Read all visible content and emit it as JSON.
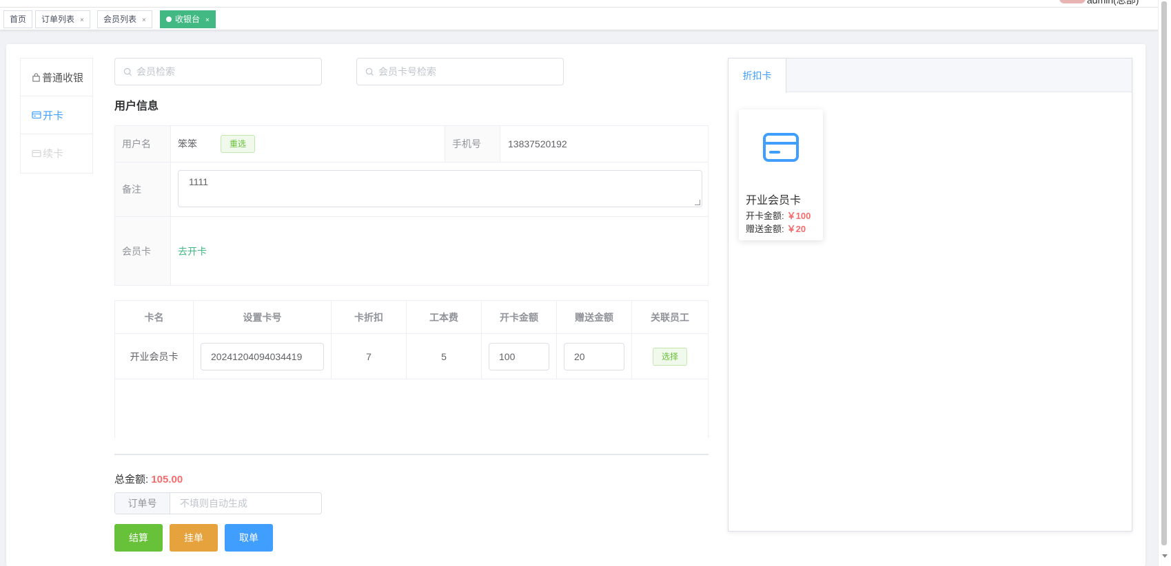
{
  "header": {
    "user_name": "admin(总部)"
  },
  "tabs": [
    {
      "label": "首页",
      "closable": false
    },
    {
      "label": "订单列表",
      "closable": true
    },
    {
      "label": "会员列表",
      "closable": true
    },
    {
      "label": "收银台",
      "closable": true,
      "active": true
    }
  ],
  "tab_close_glyph": "×",
  "side_menu": [
    {
      "label": "普通收银",
      "icon": "bag-icon"
    },
    {
      "label": "开卡",
      "icon": "card-icon",
      "active": true
    },
    {
      "label": "续卡",
      "icon": "card-icon",
      "disabled": true
    }
  ],
  "search": {
    "member_placeholder": "会员检索",
    "card_placeholder": "会员卡号检索"
  },
  "user_info": {
    "title": "用户信息",
    "username_label": "用户名",
    "username": "笨笨",
    "reselect_label": "重选",
    "phone_label": "手机号",
    "phone": "13837520192",
    "remark_label": "备注",
    "remark": "1111",
    "member_card_label": "会员卡",
    "open_card_link": "去开卡"
  },
  "card_table": {
    "headers": [
      "卡名",
      "设置卡号",
      "卡折扣",
      "工本费",
      "开卡金额",
      "赠送金额",
      "关联员工"
    ],
    "row": {
      "name": "开业会员卡",
      "card_no": "20241204094034419",
      "discount": "7",
      "fee": "5",
      "open_amount": "100",
      "gift_amount": "20",
      "select_label": "选择"
    }
  },
  "summary": {
    "total_label": "总金额:",
    "total_amount": "105.00",
    "order_no_label": "订单号",
    "order_no_placeholder": "不填则自动生成"
  },
  "actions": {
    "settle": "结算",
    "hold": "挂单",
    "cancel": "取单"
  },
  "right_panel": {
    "tab_label": "折扣卡",
    "card": {
      "name": "开业会员卡",
      "open_label": "开卡金额:",
      "open_value": "￥100",
      "gift_label": "赠送金额:",
      "gift_value": "￥20"
    }
  },
  "colors": {
    "accent_green": "#42b983",
    "primary_blue": "#409eff",
    "success": "#67c23a",
    "warning": "#e6a23c",
    "danger": "#f56c6c"
  }
}
